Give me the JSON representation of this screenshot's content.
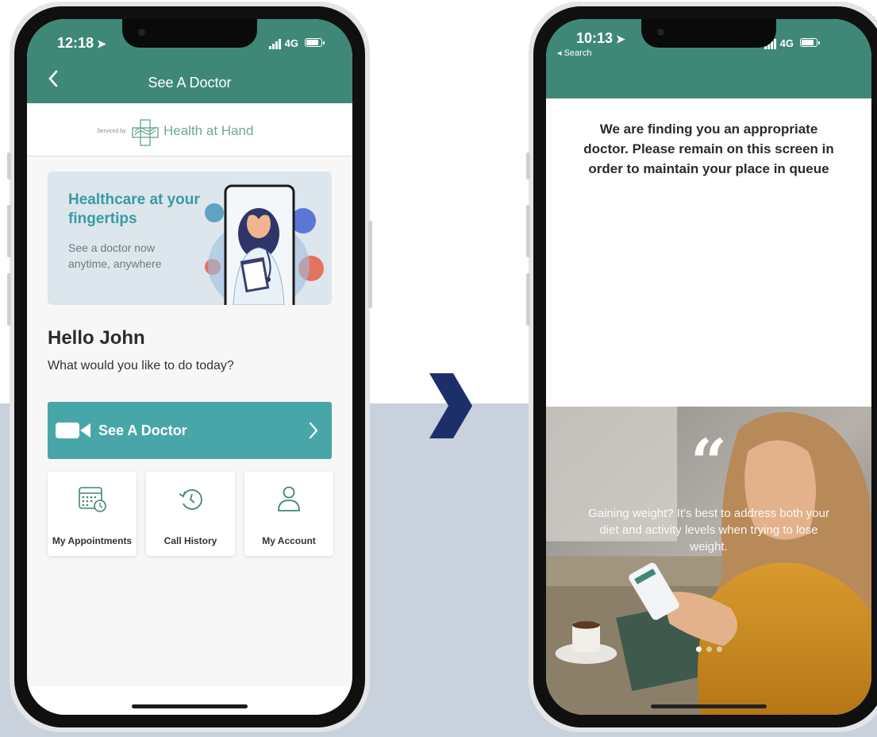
{
  "colors": {
    "brand_teal": "#3f8878",
    "cta_teal": "#48a6a8",
    "banner_bg": "#dce6ec",
    "arrow_navy": "#1d2f6b",
    "band_bg": "#c8d1dc"
  },
  "left_phone": {
    "status": {
      "time": "12:18",
      "network": "4G"
    },
    "header": {
      "back_icon": "chevron-left-icon",
      "title": "See A Doctor"
    },
    "provider": {
      "serviced_by": "Serviced by",
      "name": "Health at Hand"
    },
    "banner": {
      "title": "Healthcare at your fingertips",
      "subtitle": "See a doctor now anytime, anywhere"
    },
    "greeting": "Hello John",
    "prompt": "What would you like to do today?",
    "cta": {
      "label": "See A Doctor",
      "icon": "video-camera-icon"
    },
    "tiles": [
      {
        "label": "My Appointments",
        "icon": "calendar-clock-icon"
      },
      {
        "label": "Call History",
        "icon": "history-icon"
      },
      {
        "label": "My Account",
        "icon": "user-icon"
      }
    ]
  },
  "right_phone": {
    "status": {
      "time": "10:13",
      "network": "4G",
      "back_label": "◂ Search"
    },
    "finding_message": "We are finding you an appropriate doctor. Please remain on this screen in order to maintain your place in queue",
    "quote_mark": "“",
    "tip": "Gaining weight? It's best to address both your diet and activity levels when trying to lose weight."
  }
}
